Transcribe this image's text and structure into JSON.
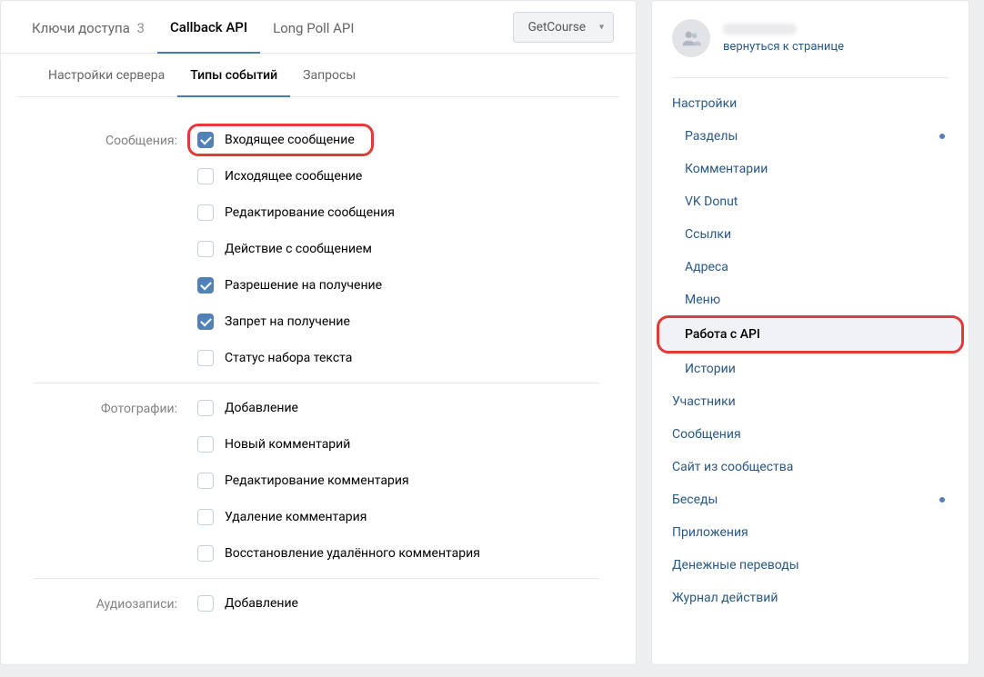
{
  "topTabs": {
    "access": {
      "label": "Ключи доступа",
      "count": "3"
    },
    "callback": {
      "label": "Callback API"
    },
    "longpoll": {
      "label": "Long Poll API"
    }
  },
  "server_dropdown": "GetCourse",
  "subtabs": {
    "server": "Настройки сервера",
    "events": "Типы событий",
    "requests": "Запросы"
  },
  "groups": [
    {
      "label": "Сообщения:",
      "items": [
        {
          "text": "Входящее сообщение",
          "checked": true,
          "highlight": true
        },
        {
          "text": "Исходящее сообщение",
          "checked": false
        },
        {
          "text": "Редактирование сообщения",
          "checked": false
        },
        {
          "text": "Действие с сообщением",
          "checked": false
        },
        {
          "text": "Разрешение на получение",
          "checked": true
        },
        {
          "text": "Запрет на получение",
          "checked": true
        },
        {
          "text": "Статус набора текста",
          "checked": false
        }
      ]
    },
    {
      "label": "Фотографии:",
      "items": [
        {
          "text": "Добавление",
          "checked": false
        },
        {
          "text": "Новый комментарий",
          "checked": false
        },
        {
          "text": "Редактирование комментария",
          "checked": false
        },
        {
          "text": "Удаление комментария",
          "checked": false
        },
        {
          "text": "Восстановление удалённого комментария",
          "checked": false
        }
      ]
    },
    {
      "label": "Аудиозаписи:",
      "items": [
        {
          "text": "Добавление",
          "checked": false
        }
      ]
    }
  ],
  "aside": {
    "back": "вернуться к странице",
    "menu": [
      {
        "text": "Настройки",
        "sub": false
      },
      {
        "text": "Разделы",
        "sub": true,
        "dot": true
      },
      {
        "text": "Комментарии",
        "sub": true
      },
      {
        "text": "VK Donut",
        "sub": true
      },
      {
        "text": "Ссылки",
        "sub": true
      },
      {
        "text": "Адреса",
        "sub": true
      },
      {
        "text": "Меню",
        "sub": true
      },
      {
        "text": "Работа с API",
        "sub": true,
        "active": true,
        "highlight": true
      },
      {
        "text": "Истории",
        "sub": true
      },
      {
        "text": "Участники",
        "sub": false
      },
      {
        "text": "Сообщения",
        "sub": false
      },
      {
        "text": "Сайт из сообщества",
        "sub": false
      },
      {
        "text": "Беседы",
        "sub": false,
        "dot": true
      },
      {
        "text": "Приложения",
        "sub": false
      },
      {
        "text": "Денежные переводы",
        "sub": false
      },
      {
        "text": "Журнал действий",
        "sub": false
      }
    ]
  }
}
